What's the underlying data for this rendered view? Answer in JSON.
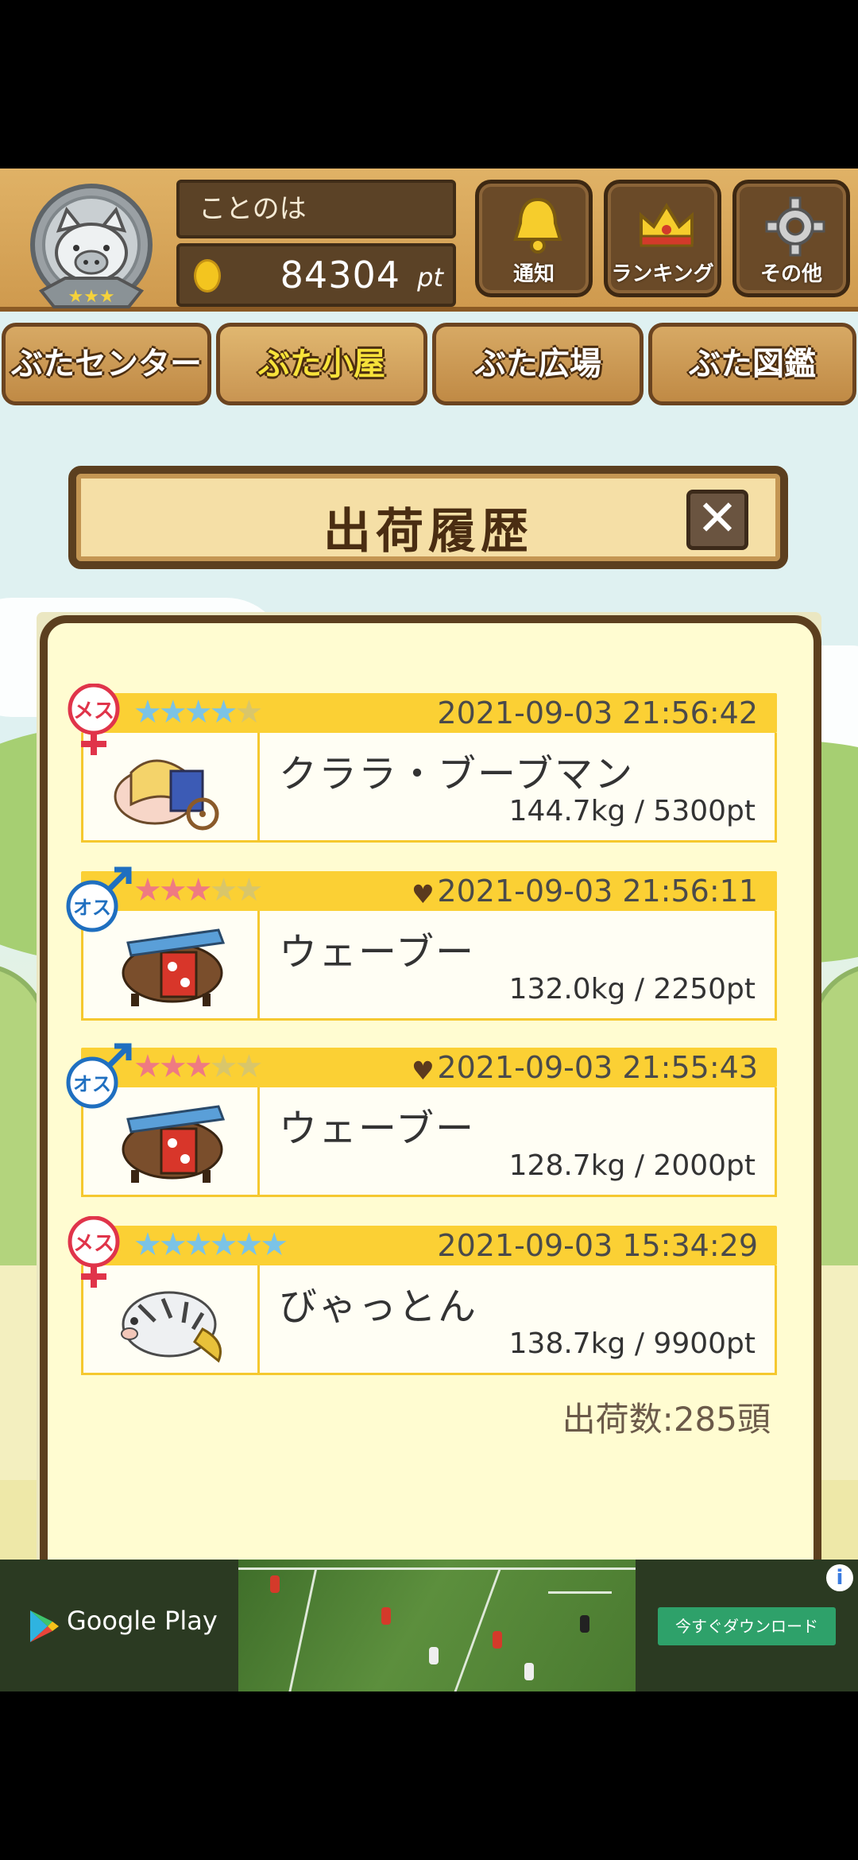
{
  "header": {
    "username": "ことのは",
    "points": "84304",
    "points_unit": "pt",
    "buttons": [
      {
        "label": "通知",
        "icon": "bell-icon"
      },
      {
        "label": "ランキング",
        "icon": "crown-icon"
      },
      {
        "label": "その他",
        "icon": "gear-icon"
      }
    ]
  },
  "nav_tabs": [
    {
      "label": "ぶたセンター",
      "active": false
    },
    {
      "label": "ぶた小屋",
      "active": true
    },
    {
      "label": "ぶた広場",
      "active": false
    },
    {
      "label": "ぶた図鑑",
      "active": false
    }
  ],
  "dialog": {
    "title": "出荷履歴",
    "close_label": "✕",
    "records": [
      {
        "gender": "female",
        "gender_label": "メス",
        "stars_total": 5,
        "stars_filled": 4,
        "favorite": false,
        "datetime": "2021-09-03 21:56:42",
        "name": "クララ・ブーブマン",
        "weight_points": "144.7kg / 5300pt"
      },
      {
        "gender": "male",
        "gender_label": "オス",
        "stars_total": 5,
        "stars_filled": 3,
        "favorite": true,
        "datetime": "2021-09-03 21:56:11",
        "name": "ウェーブー",
        "weight_points": "132.0kg / 2250pt"
      },
      {
        "gender": "male",
        "gender_label": "オス",
        "stars_total": 5,
        "stars_filled": 3,
        "favorite": true,
        "datetime": "2021-09-03 21:55:43",
        "name": "ウェーブー",
        "weight_points": "128.7kg / 2000pt"
      },
      {
        "gender": "female",
        "gender_label": "メス",
        "stars_total": 6,
        "stars_filled": 6,
        "favorite": false,
        "datetime": "2021-09-03 15:34:29",
        "name": "びゃっとん",
        "weight_points": "138.7kg / 9900pt"
      }
    ],
    "total_shipped": "出荷数:285頭"
  },
  "ad": {
    "store_label": "Google Play",
    "cta_label": "今すぐダウンロード",
    "info_label": "i"
  },
  "colors": {
    "wood_dark": "#5c3f1f",
    "star_blue": "#7bc3e6",
    "star_pink": "#ef7a82",
    "record_header": "#fbd034",
    "panel_bg": "#fffcd1",
    "cta_green": "#2ea16a"
  }
}
